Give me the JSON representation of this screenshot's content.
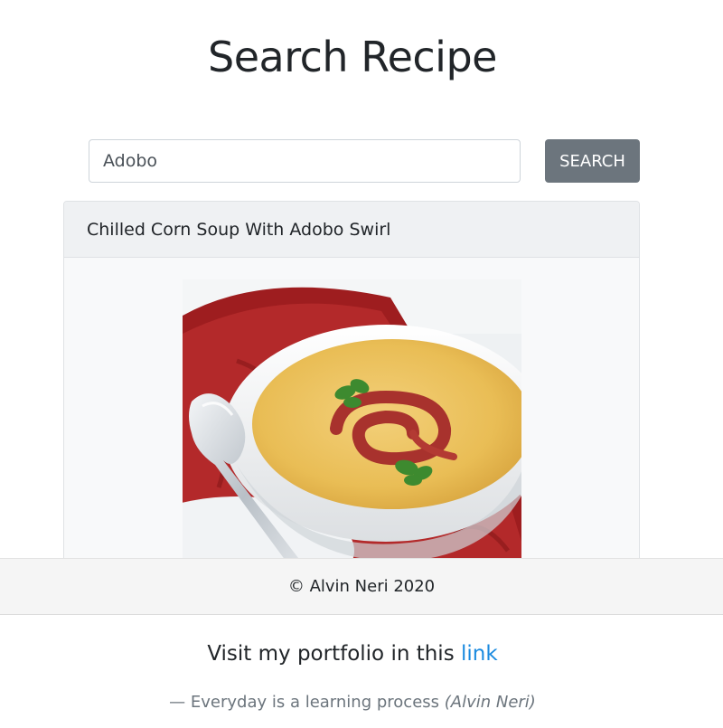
{
  "header": {
    "title": "Search Recipe"
  },
  "search": {
    "value": "Adobo",
    "button_label": "SEARCH"
  },
  "results": [
    {
      "title": "Chilled Corn Soup With Adobo Swirl",
      "image_alt": "Bowl of chilled corn soup with adobo swirl"
    }
  ],
  "footer": {
    "copyright": "© Alvin Neri 2020",
    "portfolio_text": "Visit my portfolio in this ",
    "portfolio_link": "link",
    "quote_text": "— Everyday is a learning process ",
    "quote_author": "(Alvin Neri)"
  },
  "colors": {
    "button_bg": "#6c757d",
    "link": "#1b8be0",
    "footer_bg": "#f5f5f5",
    "card_bg": "#f8f9fa",
    "card_header_bg": "#eff1f3"
  }
}
